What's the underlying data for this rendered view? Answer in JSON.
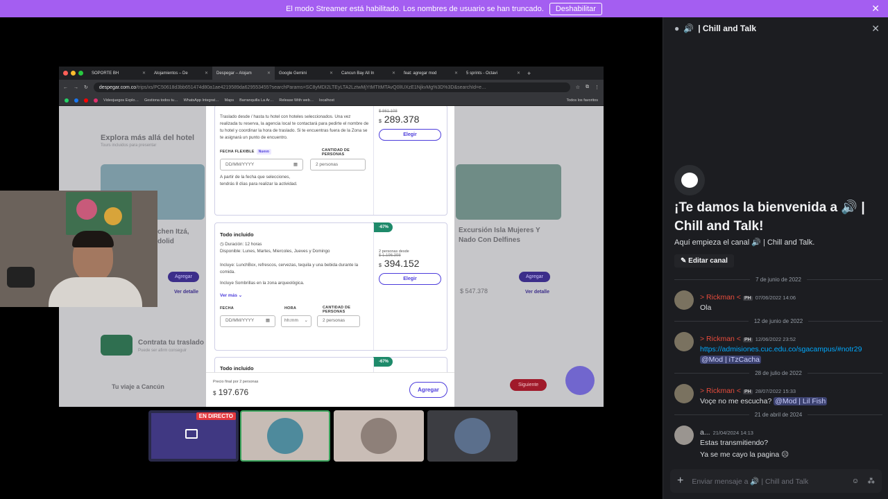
{
  "banner": {
    "text": "El modo Streamer está habilitado. Los nombres de usuario se han truncado.",
    "button": "Deshabilitar"
  },
  "browser": {
    "tabs": [
      "SOPORTE BH",
      "Alojamientos – De",
      "Despegar – Alojam",
      "Google Gemini",
      "Cancun Bay All In",
      "feat: agregar mod",
      "5 sprints - Octavi"
    ],
    "url_host": "despegar.com.co",
    "url_rest": "/trips/xs/PC50618d3bb651474d80a1ae4219589da629553455?searchParams=SC8yMDI2LTEyLTA2LztwMjYtMTItMTAvQ0lIUXzE1NjkvMg%3D%3D&searchId=e…",
    "bookmarks": [
      "Videojuegos Explo…",
      "Gestiona todos tu…",
      "WhatsApp Integrat…",
      "Maps",
      "Barranquilla La Ar…",
      "Release With web…",
      "localhost",
      "Todos los favoritos"
    ]
  },
  "page": {
    "bg_heading": "Explora más allá del hotel",
    "bg_heading_sub": "Tours incluidos para presentar",
    "bg_card_left_title": "chen Itzá,",
    "bg_card_left_sub": "dolid",
    "bg_card_right_title": "Excursión Isla Mujeres Y",
    "bg_card_right_sub": "Nado Con Delfines",
    "bg_btn": "Agregar",
    "bg_detail": "Ver detalle",
    "bg_price_right": "$ 547.378",
    "bg_transfer": "Contrata tu traslado",
    "bg_transfer_sub": "Puede ser afirm conseguir",
    "bg_trip": "Tu viaje a Cancún",
    "bg_next": "Siguiente"
  },
  "modal": {
    "card1": {
      "desc": "Traslado desde / hasta tu hotel con hoteles seleccionados. Una vez realizada tu reserva, la agencia local te contactará para pedirte el nombre de tu hotel y coordinar la hora de traslado. Si te encuentras fuera de la Zona se te asignará un punto de encuentro.",
      "fecha_label": "FECHA FLEXIBLE",
      "nuevo": "Nuevo",
      "cantidad_label": "CANTIDAD DE PERSONAS",
      "date_placeholder": "DD/MM/YYYY",
      "personas": "2 personas",
      "note": "A partir de la fecha que selecciones, tendrás 8 días para realizar la actividad.",
      "old_price": "$ 861.108",
      "currency": "$",
      "price": "289.378",
      "elegir": "Elegir"
    },
    "card2": {
      "title": "Todo incluido",
      "duration": "Duración: 12 horas",
      "available": "Disponible: Lunes, Martes, Miercoles, Jueves y Domingo",
      "includes1": "Incluye: LunchBox, refrescos, cervezas, tequila y una bebida durante la comida.",
      "includes2": "Incluye Sombrillas en la zona arqueológica.",
      "ver_mas": "Ver más",
      "discount": "-67%",
      "persons_from": "2 personas desde",
      "old_price": "$ 1.196.398",
      "currency": "$",
      "price": "394.152",
      "elegir": "Elegir",
      "fecha_label": "FECHA",
      "hora_label": "HORA",
      "cantidad_label": "CANTIDAD DE PERSONAS",
      "date_placeholder": "DD/MM/YYYY",
      "hora": "hh:mm",
      "personas": "2 personas"
    },
    "card3": {
      "title": "Todo incluido",
      "discount": "-67%"
    },
    "footer": {
      "label": "Precio final por 2 personas",
      "currency": "$",
      "price": "197.676",
      "agregar": "Agregar"
    }
  },
  "tiles": {
    "live": "EN DIRECTO"
  },
  "chat": {
    "channel": "| Chill and Talk",
    "welcome_line1": "¡Te damos la bienvenida a",
    "welcome_line2": "Chill and Talk!",
    "subline_prefix": "Aquí empieza el canal",
    "subline_channel": "| Chill and Talk.",
    "edit": "Editar canal",
    "dates": [
      "7 de junio de 2022",
      "12 de junio de 2022",
      "28 de julio de 2022",
      "21 de abril de 2024"
    ],
    "messages": [
      {
        "user": "> Rickman <",
        "tag": "PH",
        "time": "07/06/2022 14:06",
        "text": "Ola"
      },
      {
        "user": "> Rickman <",
        "tag": "PH",
        "time": "12/06/2022 23:52",
        "link": "https://admisiones.cuc.edu.co/sgacampus/#notr29",
        "mention": "@Mod | iTzCacha"
      },
      {
        "user": "> Rickman <",
        "tag": "PH",
        "time": "28/07/2022 15:33",
        "text": "Voçe no me escucha?",
        "mention": "@Mod | Lil Fish"
      },
      {
        "user": "a...",
        "time": "21/04/2024 14:13",
        "text": "Estas transmitiendo?",
        "text2": "Ya se me cayo la pagina"
      }
    ],
    "composer_prefix": "Enviar mensaje a",
    "composer_channel": "| Chill and Talk"
  }
}
